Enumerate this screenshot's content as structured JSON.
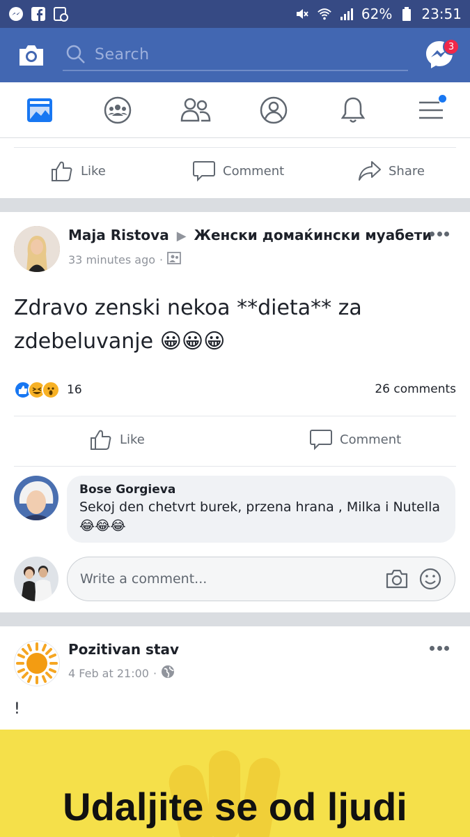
{
  "status_bar": {
    "battery": "62%",
    "time": "23:51",
    "icons": [
      "messenger-icon",
      "facebook-icon",
      "photo-notification-icon",
      "mute-icon",
      "wifi-icon",
      "signal-icon",
      "battery-icon"
    ]
  },
  "app_bar": {
    "search_placeholder": "Search",
    "messenger_badge": "3"
  },
  "tabs": [
    "news-feed-icon",
    "groups-icon",
    "friends-icon",
    "profile-icon",
    "notifications-icon",
    "menu-icon"
  ],
  "prev_post_actions": {
    "like": "Like",
    "comment": "Comment",
    "share": "Share"
  },
  "post": {
    "author": "Maja Ristova",
    "group": "Женски домаќински муабети",
    "time": "33 minutes ago",
    "text": "Zdravo zenski nekoa **dieta** za zdebeluvanje 😀😀😀",
    "reaction_count": "16",
    "comments_count": "26 comments",
    "actions": {
      "like": "Like",
      "comment": "Comment"
    },
    "comment": {
      "author": "Bose Gorgieva",
      "text": "Sekoj den chetvrt burek, przena hrana , Milka i Nutella 😂😂😂"
    },
    "write_placeholder": "Write a comment..."
  },
  "next_post": {
    "author": "Pozitivan stav",
    "time": "4 Feb at 21:00",
    "text": "!",
    "image_text": "Udaljite se od ljudi"
  },
  "colors": {
    "brand": "#4267b2",
    "status_bar": "#364a84",
    "banner": "#f5e04a"
  }
}
